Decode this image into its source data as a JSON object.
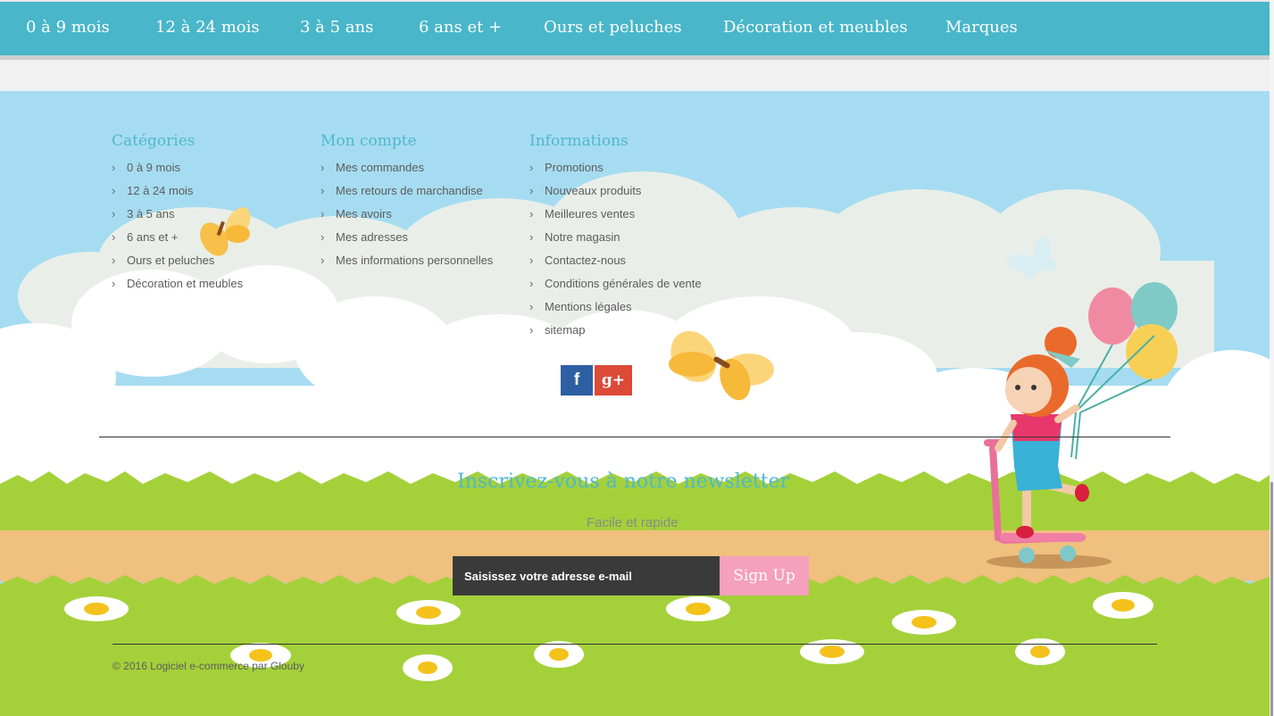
{
  "nav": {
    "items": [
      {
        "label": "0 à 9 mois"
      },
      {
        "label": "12 à 24 mois"
      },
      {
        "label": "3 à 5 ans"
      },
      {
        "label": "6 ans et +"
      },
      {
        "label": "Ours et peluches"
      },
      {
        "label": "Décoration et meubles"
      },
      {
        "label": "Marques"
      }
    ]
  },
  "footer": {
    "categories": {
      "title": "Catégories",
      "items": [
        "0 à 9 mois",
        "12 à 24 mois",
        "3 à 5 ans",
        "6 ans et +",
        "Ours et peluches",
        "Décoration et meubles"
      ]
    },
    "account": {
      "title": "Mon compte",
      "items": [
        "Mes commandes",
        "Mes retours de marchandise",
        "Mes avoirs",
        "Mes adresses",
        "Mes informations personnelles"
      ]
    },
    "info": {
      "title": "Informations",
      "items": [
        "Promotions",
        "Nouveaux produits",
        "Meilleures ventes",
        "Notre magasin",
        "Contactez-nous",
        "Conditions générales de vente",
        "Mentions légales",
        "sitemap"
      ]
    },
    "social": {
      "facebook_glyph": "f",
      "google_glyph": "g+"
    },
    "newsletter": {
      "title": "Inscrivez-vous à notre newsletter",
      "subtitle": "Facile et rapide",
      "placeholder": "Saisissez votre adresse e-mail",
      "button": "Sign Up"
    },
    "copyright": "© 2016 Logiciel e-commerce par Glouby"
  },
  "colors": {
    "nav_bg": "#49b6c9",
    "accent": "#4fb8cd",
    "sky": "#a6dcf1",
    "grass": "#a4d13a",
    "path": "#efc07e",
    "signup": "#f5a0bc",
    "facebook": "#2e5fa3",
    "google": "#dc4a38"
  }
}
